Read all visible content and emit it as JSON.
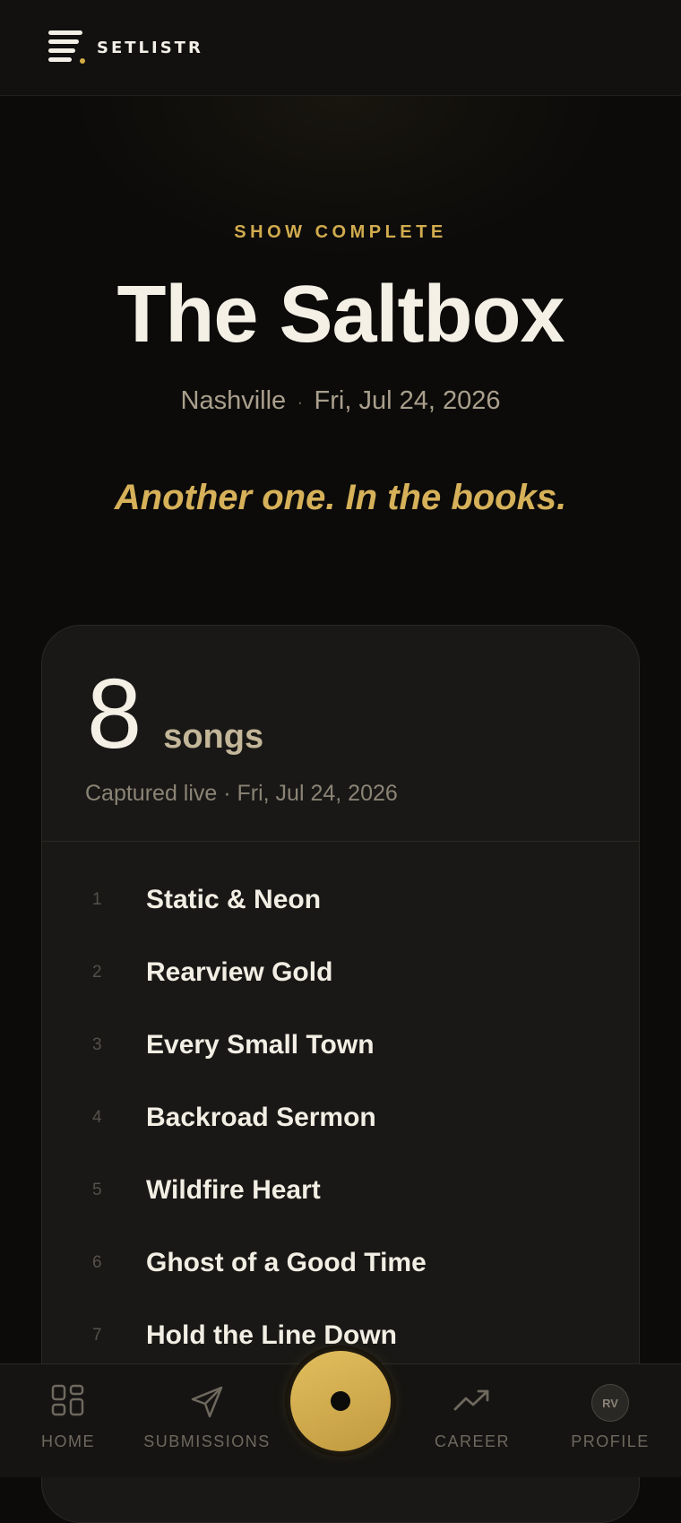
{
  "app": {
    "name": "SETLISTR"
  },
  "header": {
    "eyebrow": "SHOW COMPLETE",
    "venue": "The Saltbox",
    "city": "Nashville",
    "separator": "·",
    "date": "Fri, Jul 24, 2026",
    "tagline": "Another one. In the books."
  },
  "summary": {
    "count": "8",
    "count_label": "songs",
    "captured": "Captured live · Fri, Jul 24, 2026"
  },
  "songs": [
    {
      "num": "1",
      "title": "Static & Neon"
    },
    {
      "num": "2",
      "title": "Rearview Gold"
    },
    {
      "num": "3",
      "title": "Every Small Town"
    },
    {
      "num": "4",
      "title": "Backroad Sermon"
    },
    {
      "num": "5",
      "title": "Wildfire Heart"
    },
    {
      "num": "6",
      "title": "Ghost of a Good Time"
    },
    {
      "num": "7",
      "title": "Hold the Line Down"
    }
  ],
  "nav": {
    "home": "HOME",
    "submissions": "SUBMISSIONS",
    "career": "CAREER",
    "profile": "PROFILE",
    "avatar_initials": "RV"
  },
  "colors": {
    "accent": "#d4ad45",
    "background": "#0c0b0a",
    "card": "#191816"
  },
  "icons": {
    "home": "grid-icon",
    "submissions": "paper-plane-icon",
    "record": "record-icon",
    "career": "trending-up-icon"
  }
}
